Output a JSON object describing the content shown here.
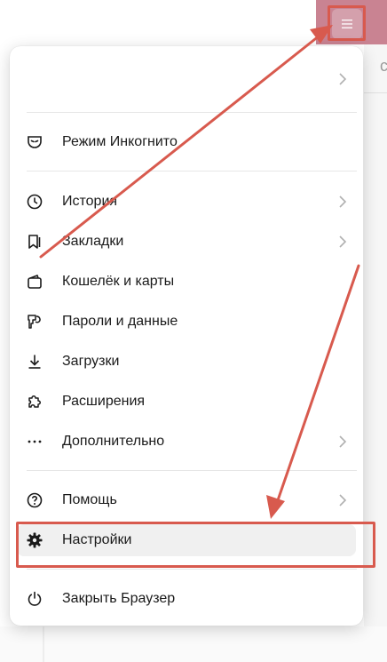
{
  "colors": {
    "accent": "#c98392",
    "annotation": "#d85a4e",
    "menu_active_bg": "#f0f0f0"
  },
  "menu": {
    "items": [
      {
        "label": "Режим Инкогнито",
        "icon": "incognito-mask-icon",
        "chevron": false
      },
      {
        "label": "История",
        "icon": "clock-history-icon",
        "chevron": true
      },
      {
        "label": "Закладки",
        "icon": "bookmarks-icon",
        "chevron": true
      },
      {
        "label": "Кошелёк и карты",
        "icon": "wallet-icon",
        "chevron": false
      },
      {
        "label": "Пароли и данные",
        "icon": "key-icon",
        "chevron": false
      },
      {
        "label": "Загрузки",
        "icon": "download-icon",
        "chevron": false
      },
      {
        "label": "Расширения",
        "icon": "puzzle-icon",
        "chevron": false
      },
      {
        "label": "Дополнительно",
        "icon": "more-dots-icon",
        "chevron": true
      },
      {
        "label": "Помощь",
        "icon": "help-circle-icon",
        "chevron": true
      },
      {
        "label": "Настройки",
        "icon": "gear-icon",
        "chevron": false,
        "active": true
      },
      {
        "label": "Закрыть Браузер",
        "icon": "power-icon",
        "chevron": false
      }
    ]
  },
  "annotations": [
    "red-arrow-to-menu-button",
    "red-arrow-to-settings"
  ]
}
